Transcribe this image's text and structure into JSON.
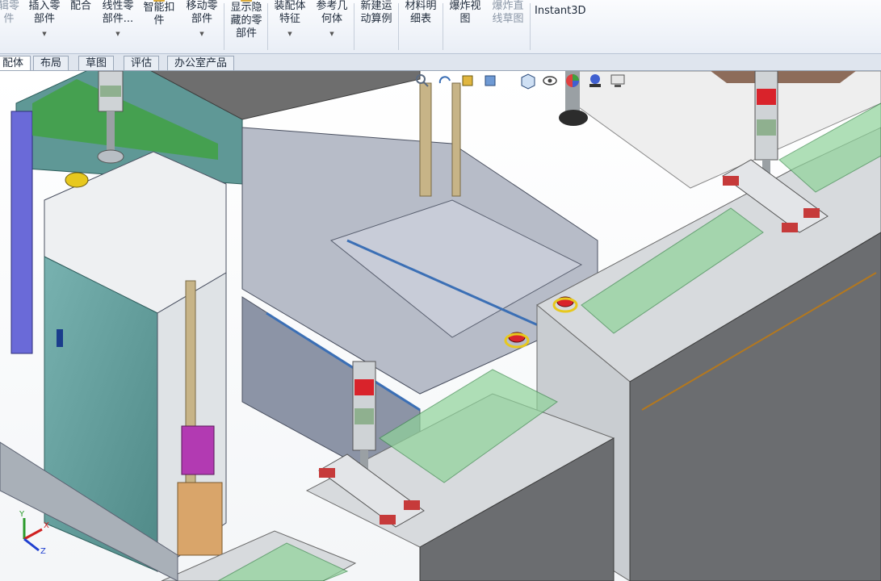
{
  "ribbon": {
    "buttons": [
      {
        "id": "edit-component",
        "label": "辑零\n件",
        "disabled": true
      },
      {
        "id": "insert-components",
        "label": "插入零\n部件"
      },
      {
        "id": "mate",
        "label": "配合"
      },
      {
        "id": "linear-pattern",
        "label": "线性零\n部件..."
      },
      {
        "id": "smart-fasteners",
        "label": "智能扣\n件"
      },
      {
        "id": "move-component",
        "label": "移动零\n部件"
      },
      {
        "id": "show-hidden",
        "label": "显示隐\n藏的零\n部件"
      },
      {
        "id": "assembly-features",
        "label": "装配体\n特征"
      },
      {
        "id": "reference-geometry",
        "label": "参考几\n何体"
      },
      {
        "id": "new-motion-study",
        "label": "新建运\n动算例"
      },
      {
        "id": "bill-of-materials",
        "label": "材料明\n细表"
      },
      {
        "id": "exploded-view",
        "label": "爆炸视\n图"
      },
      {
        "id": "explode-line-sketch",
        "label": "爆炸直\n线草图",
        "disabled": true
      }
    ],
    "instant3d": "Instant3D"
  },
  "tabs": [
    {
      "label": "配体",
      "active": true
    },
    {
      "label": "布局"
    },
    {
      "label": "草图"
    },
    {
      "label": "评估"
    },
    {
      "label": "办公室产品"
    }
  ],
  "heads_up_icons": [
    "zoom-icon",
    "rotate-view-icon",
    "section-view-icon",
    "view-orientation-icon",
    "display-style-icon",
    "hide-show-icon",
    "appearance-icon",
    "scene-icon",
    "view-settings-icon"
  ],
  "triad": {
    "x": "X",
    "y": "Y",
    "z": "Z"
  },
  "colors": {
    "ribbon_bg": "#eef2f8",
    "cabinet_teal": "#5f9e9c",
    "glass_green": "#8fd39a",
    "frame_gray": "#a9b0b8",
    "beacon_red": "#d9232b",
    "emergency_yellow": "#e7c81e"
  }
}
